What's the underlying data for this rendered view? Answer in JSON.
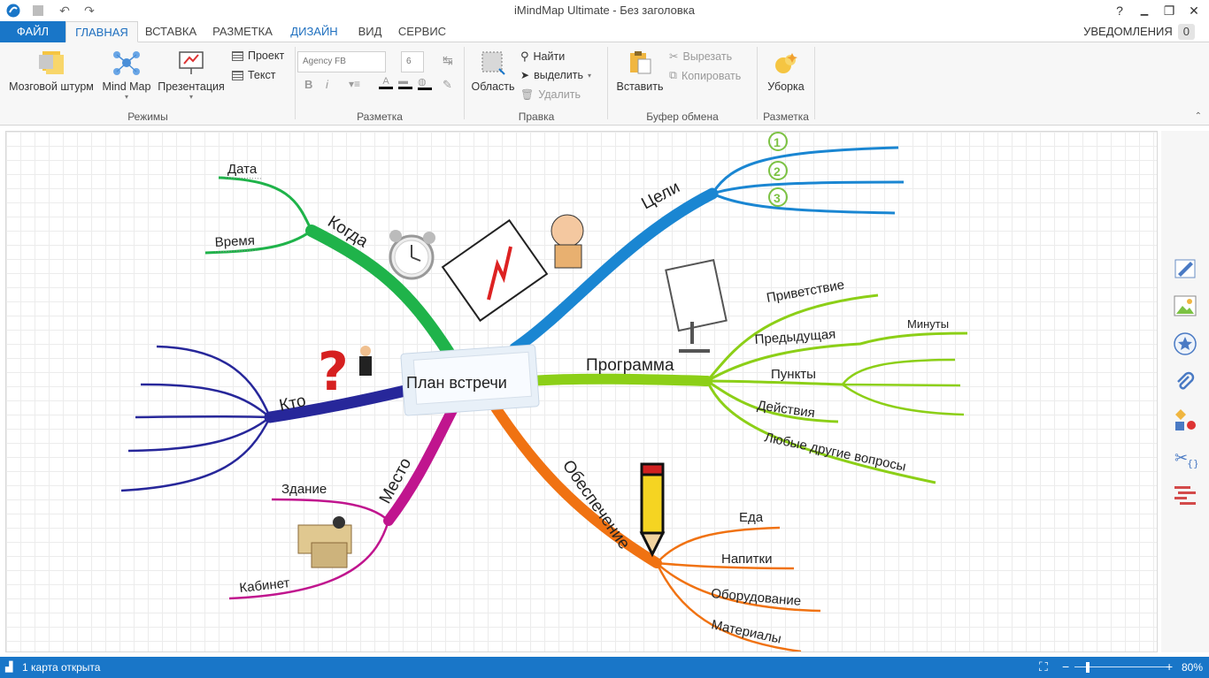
{
  "window": {
    "title": "iMindMap Ultimate - Без заголовка",
    "help": "?",
    "minimize": "▭",
    "restore": "❐",
    "close": "✕"
  },
  "tabs": {
    "file": "ФАЙЛ",
    "home": "ГЛАВНАЯ",
    "insert": "ВСТАВКА",
    "layout": "РАЗМЕТКА",
    "design": "ДИЗАЙН",
    "view": "ВИД",
    "service": "СЕРВИС"
  },
  "notifications": {
    "label": "УВЕДОМЛЕНИЯ",
    "count": "0"
  },
  "ribbon": {
    "modes": {
      "brainstorm": "Мозговой штурм",
      "mindmap": "Mind Map",
      "presentation": "Презентация",
      "project": "Проект",
      "text": "Текст",
      "group": "Режимы"
    },
    "format": {
      "font": "Agency FB",
      "size": "6",
      "bold": "B",
      "italic": "i",
      "group": "Разметка"
    },
    "edit": {
      "area": "Область",
      "find": "Найти",
      "select": "выделить",
      "delete": "Удалить",
      "group": "Правка"
    },
    "clipboard": {
      "paste": "Вставить",
      "cut": "Вырезать",
      "copy": "Копировать",
      "group": "Буфер обмена"
    },
    "cleanup": {
      "tidy": "Уборка",
      "group": "Разметка"
    }
  },
  "mindmap": {
    "central": "План встречи",
    "branches": {
      "when": {
        "label": "Когда",
        "color": "#1fb34a",
        "children": [
          "Дата",
          "Время"
        ]
      },
      "goals": {
        "label": "Цели",
        "color": "#1a86d2",
        "children": [
          "1",
          "2",
          "3"
        ]
      },
      "program": {
        "label": "Программа",
        "color": "#8ccf17",
        "children": [
          "Приветствие",
          "Предыдущая",
          "Минуты",
          "Пункты",
          "Действия",
          "Любые другие вопросы"
        ]
      },
      "who": {
        "label": "Кто",
        "color": "#27279a"
      },
      "place": {
        "label": "Место",
        "color": "#c0158e",
        "children": [
          "Здание",
          "Кабинет"
        ]
      },
      "supply": {
        "label": "Обеспечение",
        "color": "#f07212",
        "children": [
          "Еда",
          "Напитки",
          "Оборудование",
          "Материалы"
        ]
      }
    }
  },
  "sidebar": [
    "pencil-icon",
    "image-icon",
    "star-icon",
    "paperclip-icon",
    "shapes-icon",
    "scissors-icon",
    "gantt-icon"
  ],
  "status": {
    "text": "1 карта открыта",
    "zoom": "80%"
  }
}
